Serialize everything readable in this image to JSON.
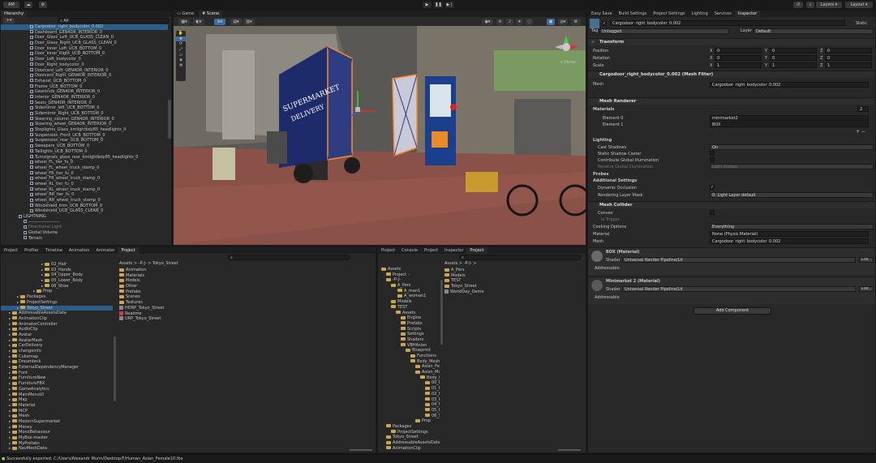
{
  "topbar": {
    "account": "AM",
    "play": "▶",
    "pause": "❚❚",
    "step": "▶❘",
    "layers": "Layers",
    "layout": "Layout"
  },
  "hierarchy": {
    "tab": "Hierarchy",
    "search_placeholder": "All",
    "items": [
      "Cargodoor_right_bodycolor_0.002",
      "Dashboard_GEN4DR_INTERIOR_0",
      "Door_Glass_Left_UCB_GLASS_CLEAN_0",
      "Door_Glass_Right_UCB_GLASS_CLEAN_0",
      "Door_Inner_Left_UCB_BOTTOM_0",
      "Door_Inner_Right_UCB_BOTTOM_0",
      "Door_Left_bodycolor_0",
      "Door_Right_bodycolor_0",
      "Doorcard_Left_GEN4DR_INTERIOR_0",
      "Doorcard_Right_GEN4DR_INTERIOR_0",
      "Exhaust_UCB_BOTTOM_0",
      "Frame_UCB_BOTTOM_0",
      "Gearknob_GEN4DR_INTERIOR_0",
      "Interior_GEN4DR_INTERIOR_0",
      "Seats_GEN4DR_INTERIOR_0",
      "Sidemirror_left_UCB_BOTTOM_0",
      "Sidemirror_Right_UCB_BOTTOM_0",
      "Steering_column_GEN4DR_INTERIOR_0",
      "Steering_wheel_GEN4DR_INTERIOR_0",
      "Stoplights_Glass_kmlightbdy85_headlights_0",
      "Suspension_Front_UCB_BOTTOM_0",
      "Suspension_rear_UCB_BOTTOM_0",
      "Sweepers_UCB_BOTTOM_0",
      "Taillights_UCB_BOTTOM_0",
      "Turnsignals_glass_rear_kmlightbdy85_headlights_0",
      "wheel_FL_tier_fu_0",
      "wheel_FL_wheel_truck_stamp_0",
      "wheel_FR_tier_fu_0",
      "wheel_FR_wheel_truck_stamp_0",
      "wheel_RL_tier_fu_0",
      "wheel_RL_wheel_truck_stamp_0",
      "wheel_RR_tier_fu_0",
      "wheel_RR_wheel_truck_stamp_0",
      "Windshield_trim_UCB_BOTTOM_0",
      "Windshield_UCB_GLASS_CLEAN_0",
      "LIGHTNING",
      "---------------------",
      "Directional Light",
      "Global Volume",
      "Terrain"
    ]
  },
  "scene": {
    "tab_game": "Game",
    "tab_scene": "Scene",
    "persp": "< Persp",
    "sign_title": "SUPERMARKET",
    "sign_sub": "DELIVERY"
  },
  "inspector_tabs": [
    "Easy Save",
    "Build Settings",
    "Project Settings",
    "Lighting",
    "Services",
    "Inspector"
  ],
  "inspector": {
    "object_name": "Cargodoor_right_bodycolor_0.002",
    "static_label": "Static",
    "tag_label": "Tag",
    "tag_value": "Untagged",
    "layer_label": "Layer",
    "layer_value": "Default",
    "transform": {
      "title": "Transform",
      "position": "Position",
      "rotation": "Rotation",
      "scale": "Scale",
      "pos": [
        "0",
        "0",
        "0"
      ],
      "rot": [
        "0",
        "0",
        "0"
      ],
      "scl": [
        "1",
        "1",
        "1"
      ],
      "x": "X",
      "y": "Y",
      "z": "Z"
    },
    "mesh_filter": {
      "title": "Cargodoor_right_bodycolor_0.002 (Mesh Filter)",
      "mesh_label": "Mesh",
      "mesh_value": "Cargodoor_right_bodycolor_0.002"
    },
    "mesh_renderer": {
      "title": "Mesh Renderer",
      "materials": "Materials",
      "count": "2",
      "el0": "Element 0",
      "el0v": "minimarket2",
      "el1": "Element 1",
      "el1v": "BOX",
      "lighting": "Lighting",
      "cast": "Cast Shadows",
      "cast_v": "On",
      "static_caster": "Static Shadow Caster",
      "gi": "Contribute Global Illumination",
      "receive": "Receive Global Illumination",
      "receive_v": "Light Probes",
      "probes": "Probes",
      "additional": "Additional Settings",
      "dyn_occ": "Dynamic Occlusion",
      "rlm": "Rendering Layer Mask",
      "rlm_v": "0: Light Layer default"
    },
    "mesh_collider": {
      "title": "Mesh Collider",
      "convex": "Convex",
      "trigger": "Is Trigger",
      "cook": "Cooking Options",
      "cook_v": "Everything",
      "mat": "Material",
      "mat_v": "None (Physic Material)",
      "mesh": "Mesh",
      "mesh_v": "Cargodoor_right_bodycolor_0.002"
    },
    "box_mat": {
      "title": "BOX (Material)",
      "shader": "Shader",
      "shader_v": "Universal Render Pipeline/Lit",
      "edit": "Edit...",
      "addr": "Addressable"
    },
    "mm_mat": {
      "title": "Minimarket 2 (Material)",
      "shader": "Shader",
      "shader_v": "Universal Render Pipeline/Lit",
      "edit": "Edit...",
      "addr": "Addressable"
    },
    "add_component": "Add Component"
  },
  "bottom_left_tabs": [
    "Project",
    "Profiler",
    "Timeline",
    "Animation",
    "Animator",
    "Project"
  ],
  "bl_tree": [
    "02_Hair",
    "03_Hands",
    "04_Upper_Body",
    "05_Lower_Body",
    "06_Shoe",
    "Prop",
    "Packages",
    "ProjectSettings",
    "Tokyo_Street",
    "AddressableAssetsData",
    "AnimationClip",
    "AnimatorController",
    "AudioClip",
    "Avatar",
    "AvatarMask",
    "CarDelivery",
    "changeinfo",
    "Cubemap",
    "Dreamteck",
    "ExternalDependencyManager",
    "Font",
    "FurnitureNew",
    "FurnitureFBX",
    "GameAnalytics",
    "MainMenuUI",
    "Map",
    "Material",
    "MCP",
    "Mesh",
    "ModernSupermarket",
    "Money",
    "MonoBehaviour",
    "MyBox-master",
    "MyPrefabs",
    "NavMeshData"
  ],
  "bl_breadcrumb": "Assets > -P-J- > Tokyo_Street",
  "bl_assets": [
    "Animation",
    "Materials",
    "Models",
    "Other",
    "Prefabs",
    "Scenes",
    "Textures",
    "HDRP_Tokyo_Street",
    "Readme",
    "URP_Tokyo_Street"
  ],
  "bottom_mid_tabs": [
    "Project",
    "Console",
    "Project",
    "Inspector",
    "Project"
  ],
  "bm_tree": [
    "Assets",
    "Project -",
    "-P-J-",
    "A_Pers",
    "A_man1",
    "A_woman1",
    "Models",
    "TEST",
    "Assets",
    "Engine",
    "Prefabs",
    "Scripts",
    "Settings",
    "Shaders",
    "VBHAsian",
    "Blueprint",
    "Functions",
    "Body_Mesh",
    "Asian_Fema",
    "Asian_Male",
    "Body_Pac",
    "00_Bas",
    "01_Hea",
    "02_Hai",
    "03_Han",
    "04_Upp",
    "05_Low",
    "06_Sho",
    "Prop",
    "Packages",
    "ProjectSettings",
    "Tokyo_Street",
    "AddressableAssetsData",
    "AnimationClip"
  ],
  "bm_breadcrumb": "Assets > -P-J- >",
  "bm_assets": [
    "A_Pers",
    "Models",
    "TEST",
    "Tokyo_Street",
    "WorldDay_Demo"
  ],
  "status": "Successfully exported: C:/Users/Alexandr Murin/Desktop/F/Human_Asian_Female10.fbx"
}
